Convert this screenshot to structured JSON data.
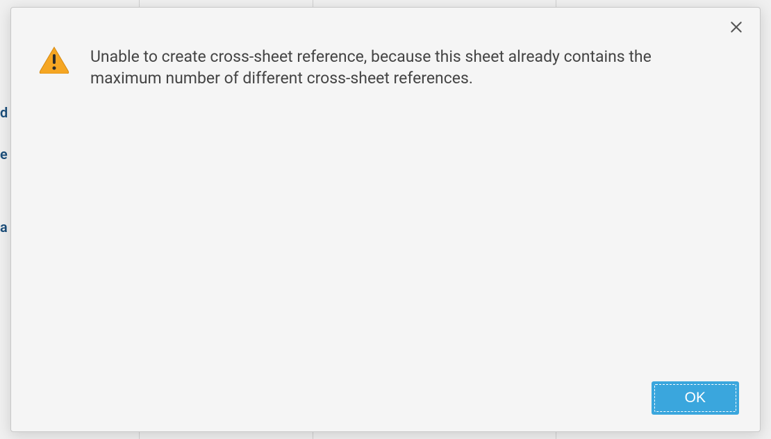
{
  "dialog": {
    "message": "Unable to create cross-sheet reference, because this sheet already contains the maximum number of different cross-sheet references.",
    "ok_label": "OK"
  },
  "backdrop": {
    "text_fragments": [
      "d",
      "e",
      "a"
    ]
  }
}
